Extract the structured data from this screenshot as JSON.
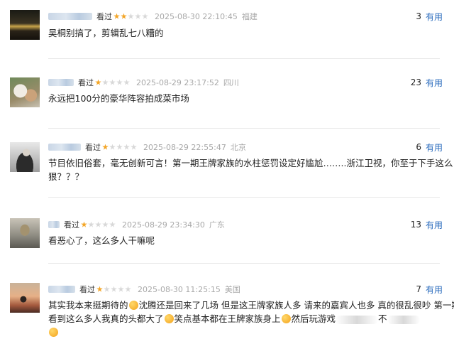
{
  "comments": [
    {
      "seen_label": "看过",
      "rating": 2,
      "max_rating": 5,
      "time": "2025-08-30 22:10:45",
      "location": "福建",
      "useful_count": "3",
      "useful_label": "有用",
      "text": "吴桐别搞了，剪辑乱七八糟的"
    },
    {
      "seen_label": "看过",
      "rating": 1,
      "max_rating": 5,
      "time": "2025-08-29 23:17:52",
      "location": "四川",
      "useful_count": "23",
      "useful_label": "有用",
      "text": "永远把100分的豪华阵容拍成菜市场"
    },
    {
      "seen_label": "看过",
      "rating": 1,
      "max_rating": 5,
      "time": "2025-08-29 22:55:47",
      "location": "北京",
      "useful_count": "6",
      "useful_label": "有用",
      "text_line1": "节目依旧俗套，毫无创新可言！第一期王牌家族的水柱惩罚设定好尴尬……..浙江卫视，你至于下手这么",
      "text_line2": "狠？？？"
    },
    {
      "seen_label": "看过",
      "rating": 1,
      "max_rating": 5,
      "time": "2025-08-29 23:34:30",
      "location": "广东",
      "useful_count": "13",
      "useful_label": "有用",
      "text": "看恶心了，这么多人干嘛呢"
    },
    {
      "seen_label": "看过",
      "rating": 1,
      "max_rating": 5,
      "time": "2025-08-30 11:25:15",
      "location": "美国",
      "useful_count": "7",
      "useful_label": "有用",
      "text_a": "其实我本来挺期待的",
      "text_b": "沈腾还是回来了几场 但是这王牌家族人多 请来的嘉宾人也多 真的很乱很吵 第一期",
      "text_c": "看到这么多人我真的头都大了",
      "text_d": "笑点基本都在王牌家族身上",
      "text_e": "然后玩游戏",
      "text_f": "不"
    }
  ]
}
